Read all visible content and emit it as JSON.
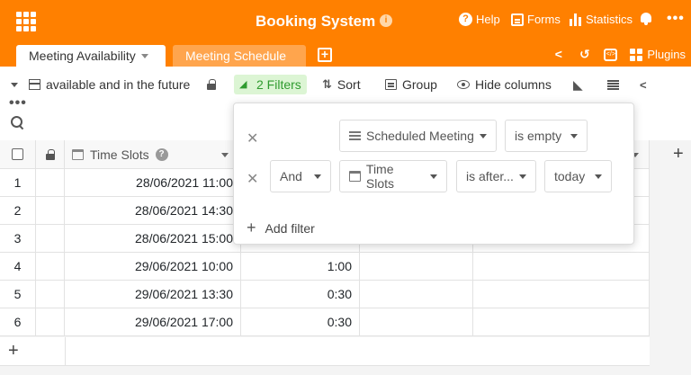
{
  "header": {
    "app_title": "Booking System",
    "info_badge": "i",
    "help_label": "Help",
    "forms_label": "Forms",
    "statistics_label": "Statistics",
    "more_label": "•••"
  },
  "tabs": [
    {
      "label": "Meeting Availability"
    },
    {
      "label": "Meeting Schedule"
    }
  ],
  "right_tools": {
    "plugins_label": "Plugins"
  },
  "toolbar": {
    "view_label": "available and in the future",
    "filters_label": "2 Filters",
    "sort_label": "Sort",
    "group_label": "Group",
    "hide_columns_label": "Hide columns",
    "more_label": "•••"
  },
  "grid": {
    "column_header": "Time Slots",
    "rows": [
      {
        "index": "1",
        "time": "28/06/2021 11:00",
        "duration": ""
      },
      {
        "index": "2",
        "time": "28/06/2021 14:30",
        "duration": ""
      },
      {
        "index": "3",
        "time": "28/06/2021 15:00",
        "duration": ""
      },
      {
        "index": "4",
        "time": "29/06/2021 10:00",
        "duration": "1:00"
      },
      {
        "index": "5",
        "time": "29/06/2021 13:30",
        "duration": "0:30"
      },
      {
        "index": "6",
        "time": "29/06/2021 17:00",
        "duration": "0:30"
      }
    ],
    "add_row_label": "+",
    "add_col_label": "+"
  },
  "filter_popover": {
    "rows": [
      {
        "conjunction": "",
        "column": "Scheduled Meeting",
        "operator": "is empty",
        "value": ""
      },
      {
        "conjunction": "And",
        "column": "Time Slots",
        "operator": "is after...",
        "value": "today"
      }
    ],
    "add_filter_label": "Add filter"
  },
  "colors": {
    "brand": "#ff8000",
    "filter_active_bg": "#dcf5d4",
    "filter_active_text": "#2f9b2f"
  }
}
